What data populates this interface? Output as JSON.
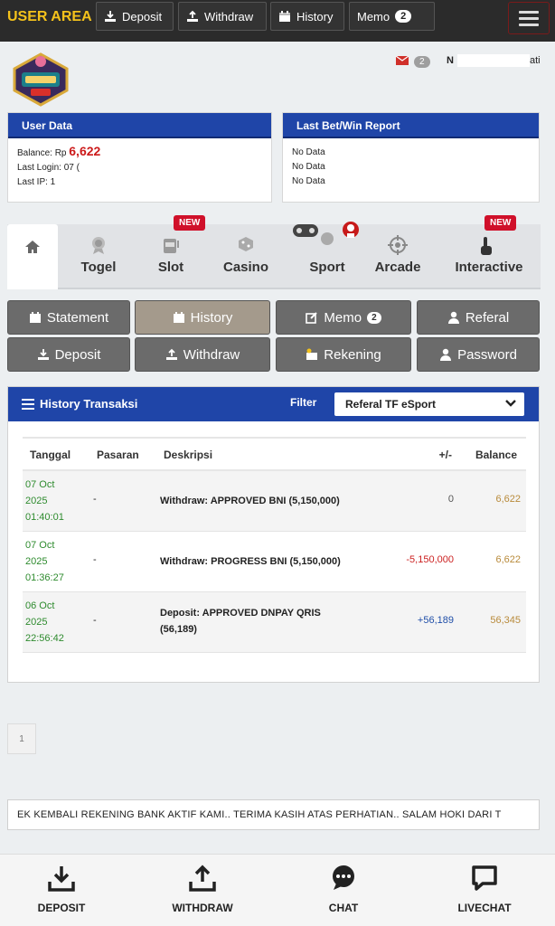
{
  "topbar": {
    "brand": "USER AREA",
    "buttons": [
      {
        "label": "Deposit",
        "icon": "deposit-icon"
      },
      {
        "label": "Withdraw",
        "icon": "withdraw-icon"
      },
      {
        "label": "History",
        "icon": "calendar-icon"
      },
      {
        "label": "Memo",
        "badge": "2"
      }
    ],
    "menu_icon": "hamburger-icon"
  },
  "header": {
    "mail_count": "2",
    "username": "N",
    "username_tail": "ati"
  },
  "user_data": {
    "title": "User Data",
    "balance_label": "Balance: Rp",
    "balance_value": "6,622",
    "last_login": "Last Login: 07 (",
    "last_ip": "Last IP: 1"
  },
  "last_bet": {
    "title": "Last Bet/Win Report",
    "rows": [
      "No Data",
      "No Data",
      "No Data"
    ]
  },
  "categories": [
    {
      "label": "",
      "icon": "home-icon"
    },
    {
      "label": "Togel",
      "icon": "togel-icon"
    },
    {
      "label": "Slot",
      "icon": "slot-icon",
      "badge": "NEW"
    },
    {
      "label": "Casino",
      "icon": "casino-icon"
    },
    {
      "label": "Sport",
      "icon": "sport-icon"
    },
    {
      "label": "Arcade",
      "icon": "arcade-icon"
    },
    {
      "label": "Interactive",
      "icon": "interactive-icon",
      "badge": "NEW"
    }
  ],
  "actions": [
    {
      "label": "Statement",
      "icon": "calendar-icon"
    },
    {
      "label": "History",
      "icon": "calendar-icon",
      "active": true
    },
    {
      "label": "Memo",
      "icon": "edit-icon",
      "badge": "2"
    },
    {
      "label": "Referal",
      "icon": "user-icon"
    },
    {
      "label": "Deposit",
      "icon": "deposit-icon"
    },
    {
      "label": "Withdraw",
      "icon": "withdraw-icon"
    },
    {
      "label": "Rekening",
      "icon": "bank-card-icon"
    },
    {
      "label": "Password",
      "icon": "user-icon"
    }
  ],
  "history": {
    "title": "History Transaksi",
    "filter_label": "Filter",
    "filter_value": "Referal TF eSport",
    "columns": [
      "Tanggal",
      "Pasaran",
      "Deskripsi",
      "+/-",
      "Balance"
    ],
    "rows": [
      {
        "date": [
          "07 Oct",
          "2025",
          "01:40:01"
        ],
        "market": "-",
        "desc": [
          "Withdraw: APPROVED BNI (5,150,000)"
        ],
        "amount": "0",
        "amount_type": "zero",
        "balance": "6,622"
      },
      {
        "date": [
          "07 Oct",
          "2025",
          "01:36:27"
        ],
        "market": "-",
        "desc": [
          "Withdraw: PROGRESS BNI (5,150,000)"
        ],
        "amount": "-5,150,000",
        "amount_type": "neg",
        "balance": "6,622"
      },
      {
        "date": [
          "06 Oct",
          "2025",
          "22:56:42"
        ],
        "market": "-",
        "desc": [
          "Deposit: APPROVED DNPAY QRIS",
          "(56,189)"
        ],
        "amount": "+56,189",
        "amount_type": "pos",
        "balance": "56,345"
      }
    ]
  },
  "pager": {
    "current": "1"
  },
  "marquee": "EK KEMBALI REKENING BANK AKTIF KAMI.. TERIMA KASIH ATAS PERHATIAN.. SALAM HOKI DARI T",
  "bottom_nav": [
    {
      "label": "DEPOSIT",
      "icon": "download-tray-icon"
    },
    {
      "label": "WITHDRAW",
      "icon": "upload-tray-icon"
    },
    {
      "label": "CHAT",
      "icon": "chat-bubble-icon"
    },
    {
      "label": "LIVECHAT",
      "icon": "livechat-icon"
    }
  ],
  "colors": {
    "brand_yellow": "#f4c21b",
    "panel_blue": "#1f45a8",
    "new_red": "#d0102a",
    "balance_red": "#cc1a1a",
    "date_green": "#2e8b2e"
  }
}
